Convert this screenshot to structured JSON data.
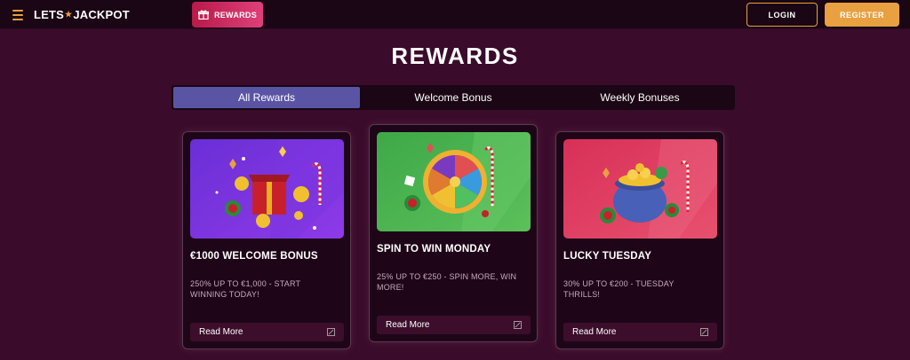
{
  "header": {
    "logo_left": "LETS",
    "logo_right": "JACKPOT",
    "rewards_label": "REWARDS",
    "login_label": "LOGIN",
    "register_label": "REGISTER"
  },
  "page": {
    "title": "REWARDS"
  },
  "tabs": [
    {
      "label": "All Rewards",
      "active": true
    },
    {
      "label": "Welcome Bonus",
      "active": false
    },
    {
      "label": "Weekly Bonuses",
      "active": false
    }
  ],
  "cards": [
    {
      "title": "€1000 WELCOME BONUS",
      "desc_line1": "250% UP TO €1,000 - START",
      "desc_line2": "WINNING TODAY!",
      "read_more": "Read More",
      "image": "gift-box-christmas-illustration"
    },
    {
      "title": "SPIN TO WIN MONDAY",
      "desc_line1": "25% UP TO €250 - SPIN MORE, WIN",
      "desc_line2": "MORE!",
      "read_more": "Read More",
      "image": "prize-wheel-christmas-illustration"
    },
    {
      "title": "LUCKY TUESDAY",
      "desc_line1": "30% UP TO €200 - TUESDAY",
      "desc_line2": "THRILLS!",
      "read_more": "Read More",
      "image": "pot-of-gold-christmas-illustration"
    }
  ],
  "colors": {
    "background": "#3a0b2a",
    "header": "#1a0614",
    "accent": "#e8a040",
    "rewards_button": "#d0305e",
    "active_tab": "#5a54a4"
  }
}
